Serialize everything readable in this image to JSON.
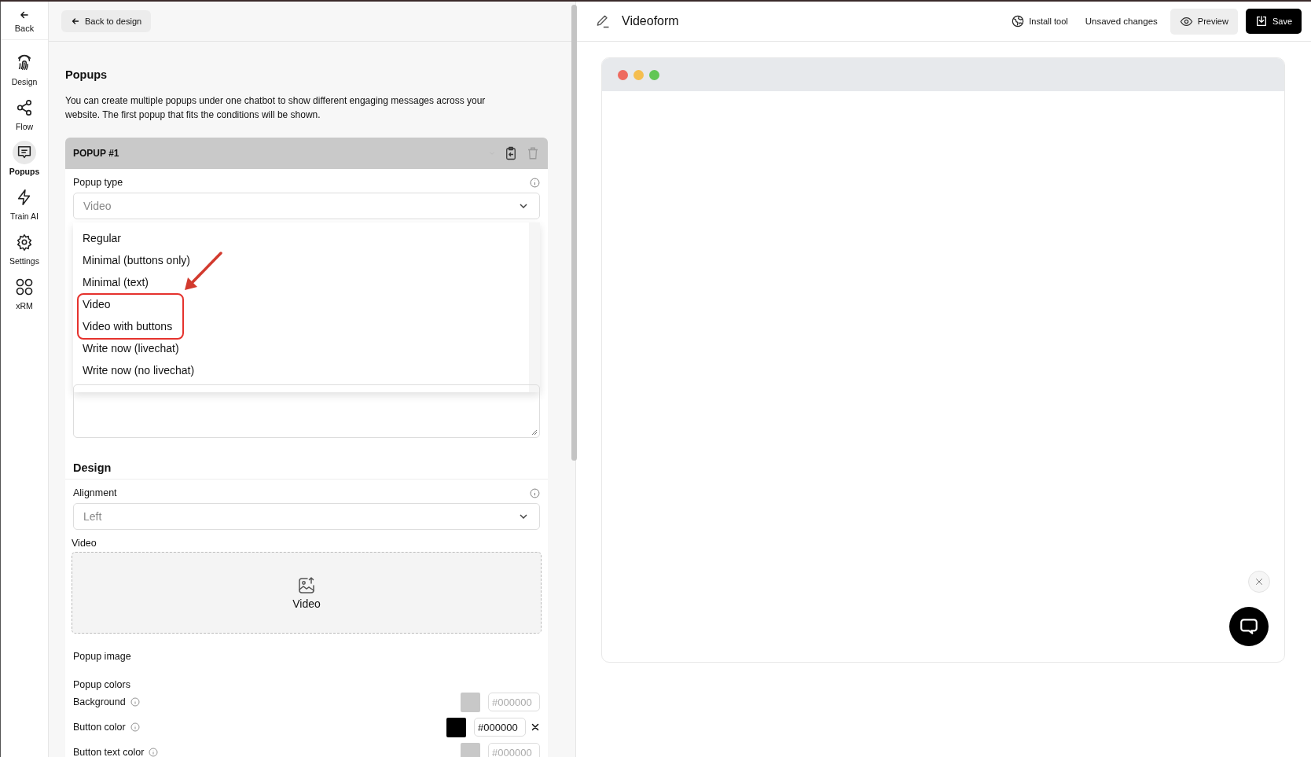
{
  "sidebar": {
    "back": "Back",
    "items": [
      {
        "label": "Design",
        "kind": "fingerprint",
        "selected": false
      },
      {
        "label": "Flow",
        "kind": "share",
        "selected": false
      },
      {
        "label": "Popups",
        "kind": "chat",
        "selected": true
      },
      {
        "label": "Train AI",
        "kind": "bolt",
        "selected": false
      },
      {
        "label": "Settings",
        "kind": "gear",
        "selected": false
      },
      {
        "label": "xRM",
        "kind": "grid",
        "selected": false
      }
    ]
  },
  "editor": {
    "back_button": "Back to design",
    "title": "Popups",
    "description": "You can create multiple popups under one chatbot to show different engaging messages across your website. The first popup that fits the conditions will be shown.",
    "popup": {
      "title": "POPUP #1",
      "type_label": "Popup type",
      "type_value": "Video",
      "type_options": [
        "Regular",
        "Minimal (buttons only)",
        "Minimal (text)",
        "Video",
        "Video with buttons",
        "Write now (livechat)",
        "Write now (no livechat)"
      ],
      "design_title": "Design",
      "alignment_label": "Alignment",
      "alignment_value": "Left",
      "video_label": "Video",
      "video_drop": "Video",
      "image_label": "Popup image",
      "colors_label": "Popup colors",
      "colors": [
        {
          "label": "Background",
          "color": "#c8c8c8",
          "placeholder": "#000000",
          "clearable": false
        },
        {
          "label": "Button color",
          "color": "#000000",
          "value": "#000000",
          "clearable": true
        },
        {
          "label": "Button text color",
          "color": "#c8c8c8",
          "placeholder": "#000000",
          "clearable": false
        }
      ]
    }
  },
  "preview": {
    "title": "Videoform",
    "install": "Install tool",
    "status": "Unsaved changes",
    "preview_button": "Preview",
    "save_button": "Save"
  }
}
